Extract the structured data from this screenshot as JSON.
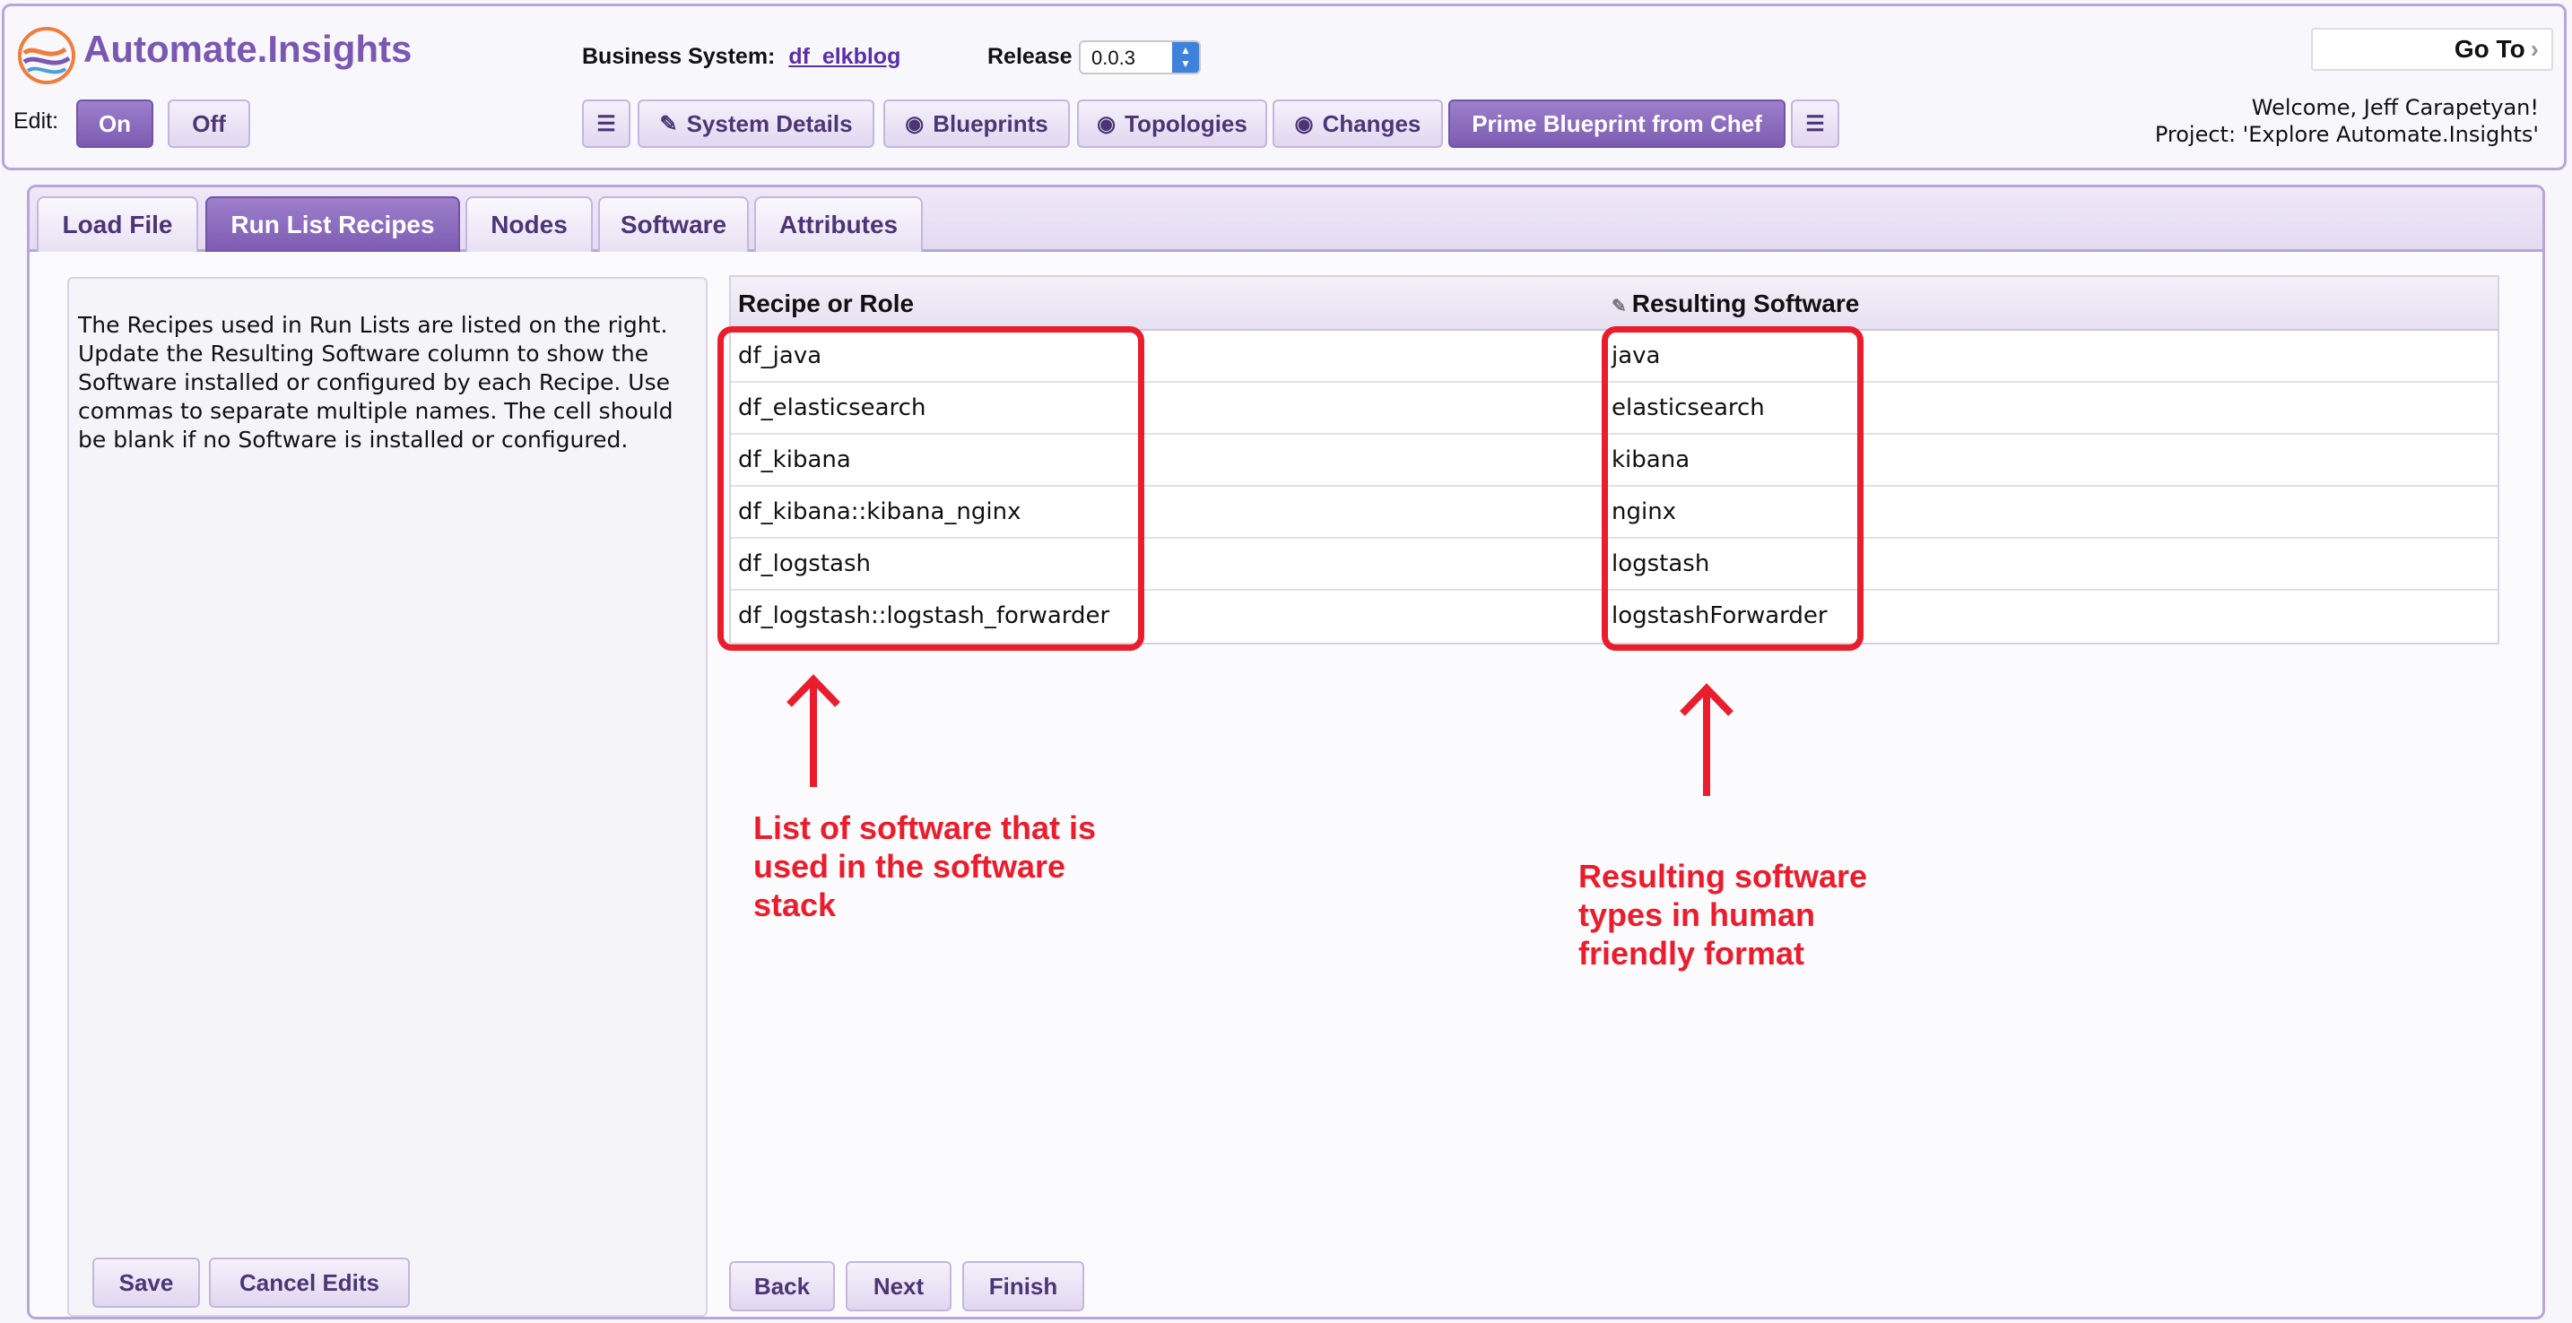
{
  "header": {
    "app_title": "Automate.Insights",
    "business_system_label": "Business System:",
    "business_system_value": "df_elkblog",
    "release_label": "Release",
    "release_value": "0.0.3",
    "edit_label": "Edit:",
    "edit_on": "On",
    "edit_off": "Off",
    "goto_label": "Go To",
    "welcome": "Welcome, Jeff Carapetyan!",
    "project": "Project: 'Explore Automate.Insights'",
    "nav": [
      {
        "label": "System Details"
      },
      {
        "label": "Blueprints"
      },
      {
        "label": "Topologies"
      },
      {
        "label": "Changes"
      },
      {
        "label": "Prime Blueprint from Chef"
      }
    ]
  },
  "tabs": [
    {
      "label": "Load File"
    },
    {
      "label": "Run List Recipes"
    },
    {
      "label": "Nodes"
    },
    {
      "label": "Software"
    },
    {
      "label": "Attributes"
    }
  ],
  "help_text": "The Recipes used in Run Lists are listed on the right. Update the Resulting Software column to show the Software installed or configured by each Recipe. Use commas to separate multiple names. The cell should be blank if no Software is installed or configured.",
  "table": {
    "col1": "Recipe or Role",
    "col2": "Resulting Software",
    "rows": [
      {
        "recipe": "df_java",
        "software": "java"
      },
      {
        "recipe": "df_elasticsearch",
        "software": "elasticsearch"
      },
      {
        "recipe": "df_kibana",
        "software": "kibana"
      },
      {
        "recipe": "df_kibana::kibana_nginx",
        "software": "nginx"
      },
      {
        "recipe": "df_logstash",
        "software": "logstash"
      },
      {
        "recipe": "df_logstash::logstash_forwarder",
        "software": "logstashForwarder"
      }
    ]
  },
  "buttons": {
    "save": "Save",
    "cancel": "Cancel Edits",
    "back": "Back",
    "next": "Next",
    "finish": "Finish"
  },
  "annotations": {
    "left_line1": "List of software that is",
    "left_line2": "used in the software",
    "left_line3": "stack",
    "right_line1": "Resulting software",
    "right_line2": "types in human",
    "right_line3": "friendly format"
  },
  "colors": {
    "accent": "#7a57b3",
    "active_button": "#8a6bbf",
    "annotation": "#ea1d2c"
  }
}
